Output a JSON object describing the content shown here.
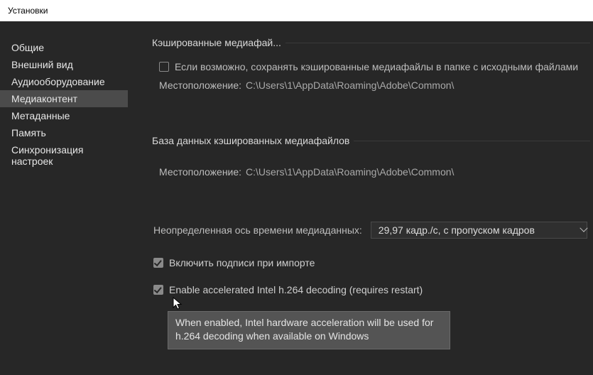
{
  "window": {
    "title": "Установки"
  },
  "sidebar": {
    "items": [
      {
        "label": "Общие"
      },
      {
        "label": "Внешний вид"
      },
      {
        "label": "Аудиооборудование"
      },
      {
        "label": "Медиаконтент"
      },
      {
        "label": "Метаданные"
      },
      {
        "label": "Память"
      },
      {
        "label": "Синхронизация настроек"
      }
    ],
    "selected_index": 3
  },
  "sections": {
    "cache": {
      "legend": "Кэшированные медиафай...",
      "checkbox_label": "Если возможно, сохранять кэшированные медиафайлы в папке с исходными файлами",
      "location_label": "Местоположение:",
      "location_value": "C:\\Users\\1\\AppData\\Roaming\\Adobe\\Common\\"
    },
    "db": {
      "legend": "База данных кэшированных медиафайлов",
      "location_label": "Местоположение:",
      "location_value": "C:\\Users\\1\\AppData\\Roaming\\Adobe\\Common\\"
    }
  },
  "timebase": {
    "label": "Неопределенная ось времени медиаданных:",
    "value": "29,97 кадр./с, с пропуском кадров"
  },
  "checks": {
    "captions_label": "Включить подписи при импорте",
    "intel_label": "Enable accelerated Intel h.264 decoding (requires restart)"
  },
  "tooltip": {
    "text": "When enabled, Intel hardware acceleration will be used for h.264 decoding when available on Windows"
  }
}
